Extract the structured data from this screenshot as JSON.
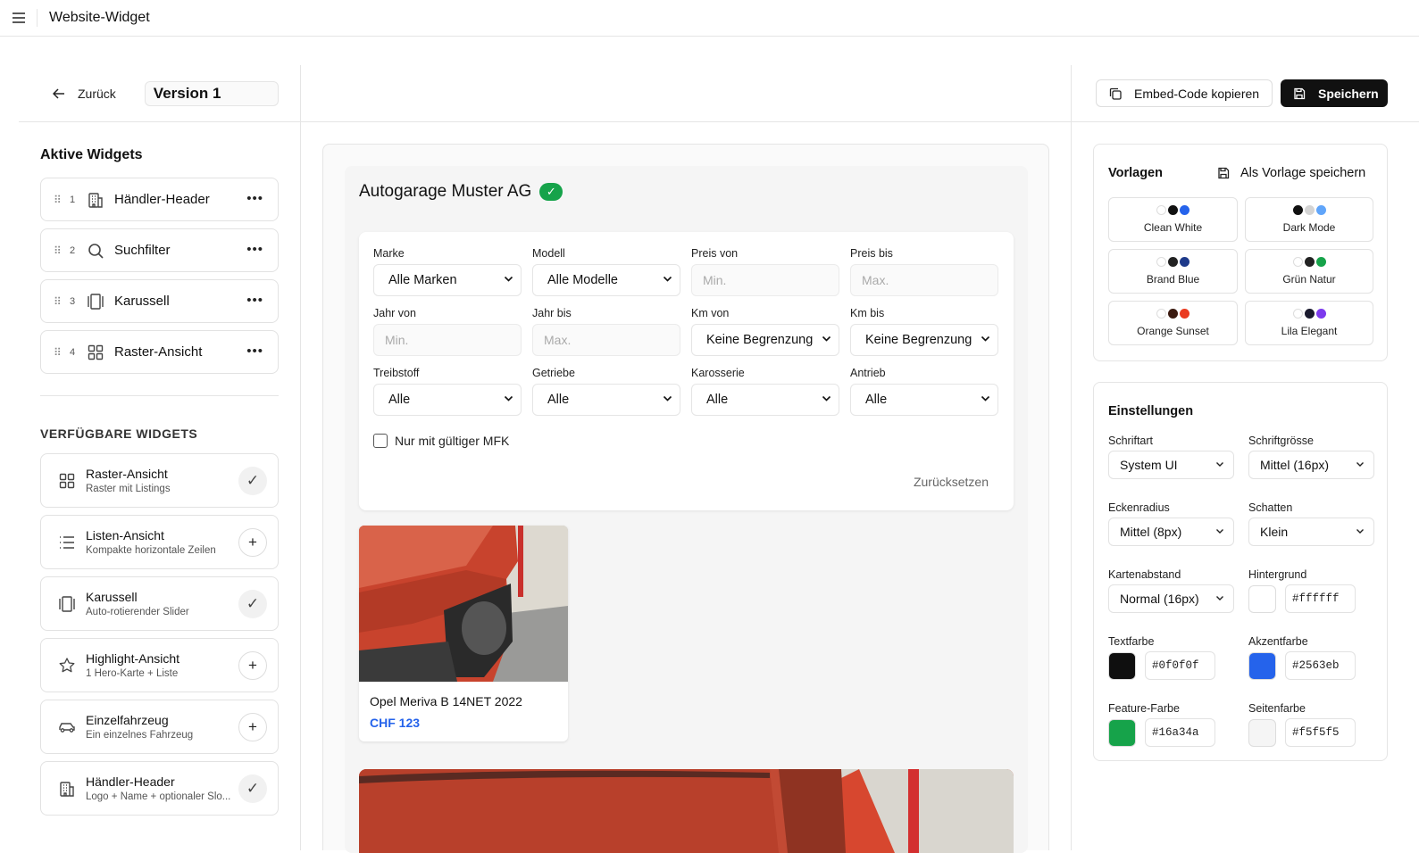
{
  "app": {
    "title": "Website-Widget"
  },
  "header": {
    "back_label": "Zurück",
    "version_name": "Version 1",
    "embed_label": "Embed-Code kopieren",
    "save_label": "Speichern"
  },
  "sidebar": {
    "active_title": "Aktive Widgets",
    "active_items": [
      {
        "num": "1",
        "label": "Händler-Header",
        "icon": "building-icon"
      },
      {
        "num": "2",
        "label": "Suchfilter",
        "icon": "search-icon"
      },
      {
        "num": "3",
        "label": "Karussell",
        "icon": "carousel-icon"
      },
      {
        "num": "4",
        "label": "Raster-Ansicht",
        "icon": "grid-icon"
      }
    ],
    "available_title": "VERFÜGBARE WIDGETS",
    "available_items": [
      {
        "title": "Raster-Ansicht",
        "desc": "Raster mit Listings",
        "icon": "grid-icon",
        "state": "added"
      },
      {
        "title": "Listen-Ansicht",
        "desc": "Kompakte horizontale Zeilen",
        "icon": "list-icon",
        "state": "add"
      },
      {
        "title": "Karussell",
        "desc": "Auto-rotierender Slider",
        "icon": "carousel-icon",
        "state": "added"
      },
      {
        "title": "Highlight-Ansicht",
        "desc": "1 Hero-Karte + Liste",
        "icon": "star-icon",
        "state": "add"
      },
      {
        "title": "Einzelfahrzeug",
        "desc": "Ein einzelnes Fahrzeug",
        "icon": "car-icon",
        "state": "add"
      },
      {
        "title": "Händler-Header",
        "desc": "Logo + Name + optionaler Slo...",
        "icon": "building-icon",
        "state": "added"
      }
    ]
  },
  "preview": {
    "dealer_name": "Autogarage Muster AG",
    "filters": [
      {
        "label": "Marke",
        "value": "Alle Marken",
        "kind": "select"
      },
      {
        "label": "Modell",
        "value": "Alle Modelle",
        "kind": "select"
      },
      {
        "label": "Preis von",
        "value": "Min.",
        "kind": "input"
      },
      {
        "label": "Preis bis",
        "value": "Max.",
        "kind": "input"
      },
      {
        "label": "Jahr von",
        "value": "Min.",
        "kind": "input"
      },
      {
        "label": "Jahr bis",
        "value": "Max.",
        "kind": "input"
      },
      {
        "label": "Km von",
        "value": "Keine Begrenzung",
        "kind": "select"
      },
      {
        "label": "Km bis",
        "value": "Keine Begrenzung",
        "kind": "select"
      },
      {
        "label": "Treibstoff",
        "value": "Alle",
        "kind": "select"
      },
      {
        "label": "Getriebe",
        "value": "Alle",
        "kind": "select"
      },
      {
        "label": "Karosserie",
        "value": "Alle",
        "kind": "select"
      },
      {
        "label": "Antrieb",
        "value": "Alle",
        "kind": "select"
      }
    ],
    "mfk_label": "Nur mit gültiger MFK",
    "reset_label": "Zurücksetzen",
    "car": {
      "title": "Opel Meriva B 14NET 2022",
      "price": "CHF 123"
    }
  },
  "templates": {
    "title": "Vorlagen",
    "save_as": "Als Vorlage speichern",
    "items": [
      {
        "name": "Clean White",
        "colors": [
          "#ffffff",
          "#111111",
          "#2563eb"
        ]
      },
      {
        "name": "Dark Mode",
        "colors": [
          "#111111",
          "#d4d4d4",
          "#60a5fa"
        ]
      },
      {
        "name": "Brand Blue",
        "colors": [
          "#ffffff",
          "#222222",
          "#1e3a8a"
        ]
      },
      {
        "name": "Grün Natur",
        "colors": [
          "#ffffff",
          "#222222",
          "#16a34a"
        ]
      },
      {
        "name": "Orange Sunset",
        "colors": [
          "#ffffff",
          "#3b1a10",
          "#ea3a1f"
        ]
      },
      {
        "name": "Lila Elegant",
        "colors": [
          "#ffffff",
          "#1a1a2e",
          "#7c3aed"
        ]
      }
    ]
  },
  "settings": {
    "title": "Einstellungen",
    "fields": [
      {
        "label": "Schriftart",
        "value": "System UI",
        "kind": "select"
      },
      {
        "label": "Schriftgrösse",
        "value": "Mittel (16px)",
        "kind": "select"
      },
      {
        "label": "Eckenradius",
        "value": "Mittel (8px)",
        "kind": "select"
      },
      {
        "label": "Schatten",
        "value": "Klein",
        "kind": "select"
      },
      {
        "label": "Kartenabstand",
        "value": "Normal (16px)",
        "kind": "select"
      },
      {
        "label": "Hintergrund",
        "value": "#ffffff",
        "kind": "color"
      },
      {
        "label": "Textfarbe",
        "value": "#0f0f0f",
        "kind": "color"
      },
      {
        "label": "Akzentfarbe",
        "value": "#2563eb",
        "kind": "color"
      },
      {
        "label": "Feature-Farbe",
        "value": "#16a34a",
        "kind": "color"
      },
      {
        "label": "Seitenfarbe",
        "value": "#f5f5f5",
        "kind": "color"
      }
    ]
  }
}
